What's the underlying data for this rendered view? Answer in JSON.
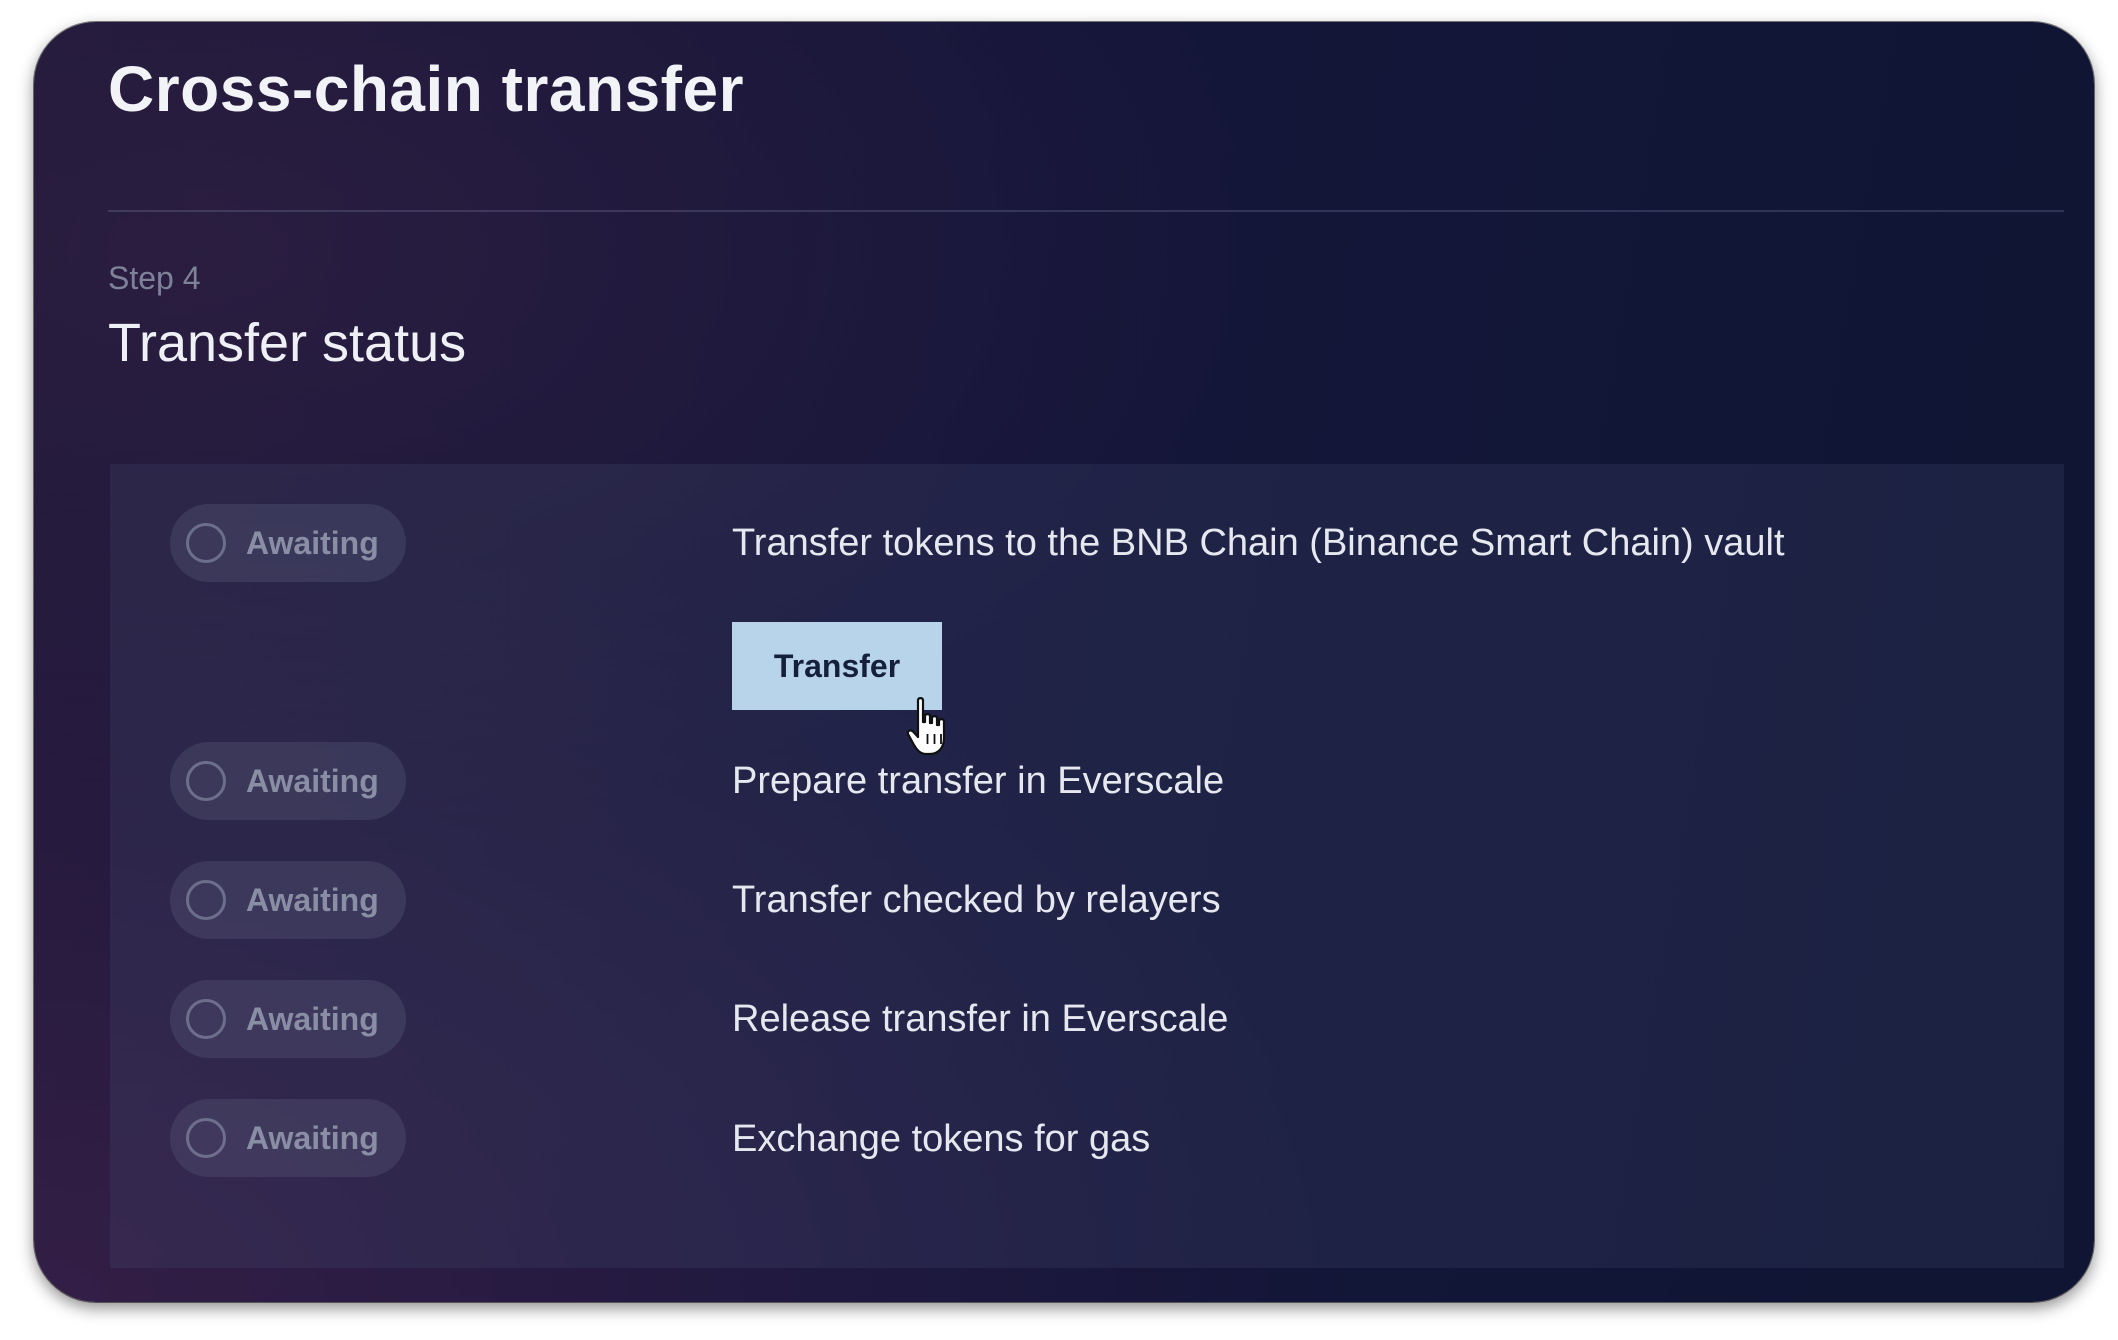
{
  "header": {
    "title": "Cross-chain transfer"
  },
  "step": {
    "label": "Step 4",
    "title": "Transfer status"
  },
  "steps": [
    {
      "status": "Awaiting",
      "text": "Transfer tokens to the BNB Chain (Binance Smart Chain) vault",
      "action_label": "Transfer"
    },
    {
      "status": "Awaiting",
      "text": "Prepare transfer in Everscale"
    },
    {
      "status": "Awaiting",
      "text": "Transfer checked by relayers"
    },
    {
      "status": "Awaiting",
      "text": "Release transfer in Everscale"
    },
    {
      "status": "Awaiting",
      "text": "Exchange tokens for gas"
    }
  ],
  "icons": {
    "status": "circle-outline-icon",
    "cursor": "hand-pointer-cursor-icon"
  },
  "colors": {
    "background": "#15163a",
    "button": "#b8d4ea",
    "text": "#e6e8ef",
    "muted": "#8a8ea5"
  }
}
